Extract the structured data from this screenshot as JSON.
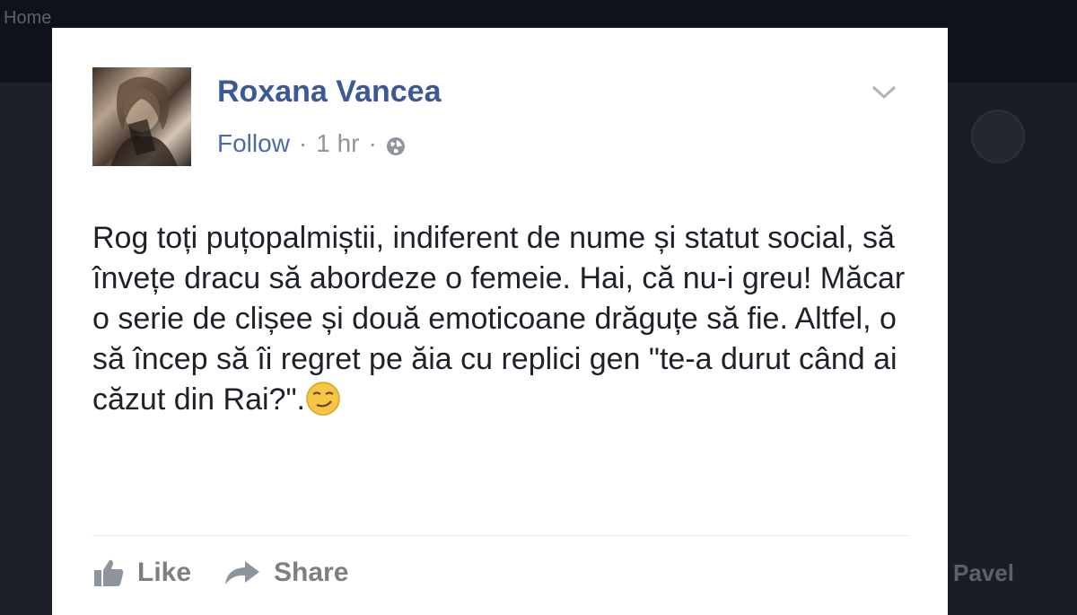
{
  "background": {
    "home_label": "Home",
    "right_name": "Pavel"
  },
  "post": {
    "author": "Roxana Vancea",
    "follow_label": "Follow",
    "separator": "·",
    "time": "1 hr",
    "privacy_icon": "globe-icon",
    "text": "Rog toți puțopalmiștii, indiferent de nume și statut social, să învețe dracu să abordeze o femeie. Hai, că nu-i greu! Măcar o serie de clișee și două emoticoane drăguțe să fie. Altfel, o să încep să îi regret pe ăia cu replici gen \"te-a durut când ai căzut din Rai?\".",
    "emoji": "smirk-emoji"
  },
  "actions": {
    "like_label": "Like",
    "share_label": "Share"
  },
  "colors": {
    "author": "#3b5998",
    "meta": "#90949c",
    "text": "#1d2129",
    "action": "#7f7f7f"
  }
}
